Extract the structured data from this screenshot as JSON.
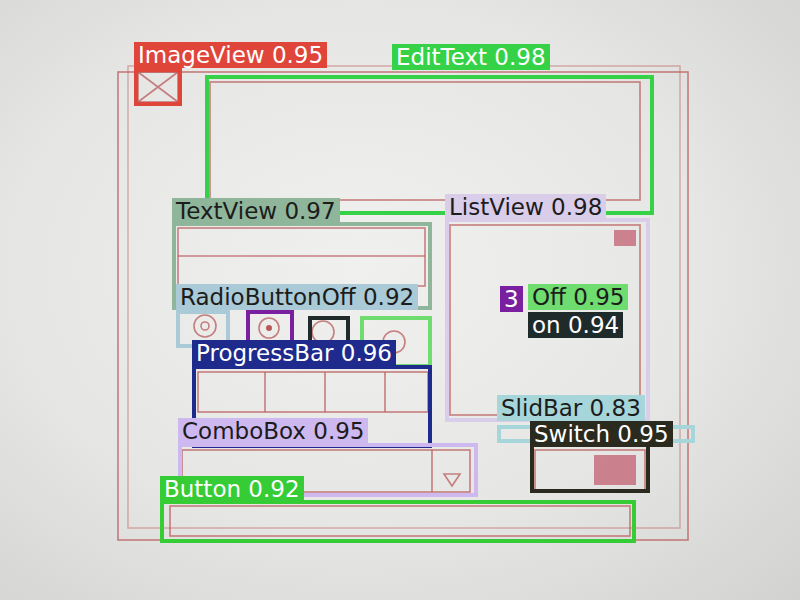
{
  "detections": [
    {
      "label": "ImageView 0.95",
      "color": "#e0453a"
    },
    {
      "label": "EditText 0.98",
      "color": "#35d247"
    },
    {
      "label": "TextView 0.97",
      "color": "#8fb59a"
    },
    {
      "label": "ListView 0.98",
      "color": "#d9cdea"
    },
    {
      "label": "RadioButtonOff 0.92",
      "color": "#a9cad6"
    },
    {
      "label": "3",
      "color": "#7a1fa0"
    },
    {
      "label": "on 0.94",
      "color": "#1f2b2b"
    },
    {
      "label": "Off 0.95",
      "color": "#6edc6e"
    },
    {
      "label": "ProgressBar 0.96",
      "color": "#1e2a8c"
    },
    {
      "label": "ComboBox 0.95",
      "color": "#cdb8f0"
    },
    {
      "label": "SlidBar 0.83",
      "color": "#a6d6da"
    },
    {
      "label": "Switch 0.95",
      "color": "#2a2a1e"
    },
    {
      "label": "Button 0.92",
      "color": "#36cc36"
    }
  ]
}
